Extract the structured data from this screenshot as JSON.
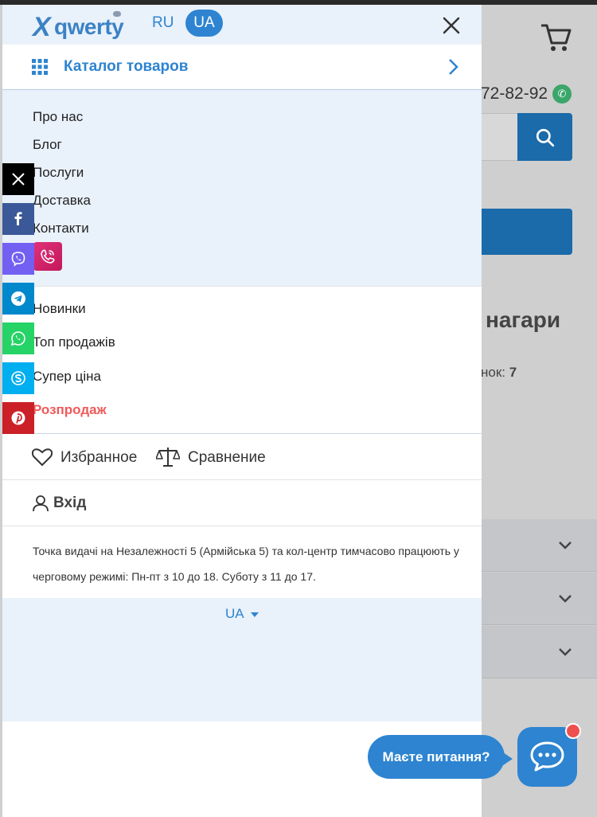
{
  "background": {
    "phone_fragment": "72-82-92",
    "heading_fragment": "нагари",
    "count_fragment": "нок:",
    "count_value": "7"
  },
  "header": {
    "logo_text": "qwerty",
    "lang_ru": "RU",
    "lang_ua": "UA"
  },
  "catalog": {
    "label": "Каталог товаров"
  },
  "info_links": [
    "Про нас",
    "Блог",
    "Послуги",
    "Доставка",
    "Контакти"
  ],
  "promo_links": [
    "Новинки",
    "Топ продажів",
    "Супер ціна",
    "Розпродаж"
  ],
  "favorites": {
    "favorites_label": "Избранное",
    "compare_label": "Сравнение"
  },
  "login": {
    "label": "Вхід"
  },
  "notice": {
    "text": "Точка видачі на Незалежності 5 (Армійська 5) та кол-центр тимчасово працюють у черговому режимі: Пн-пт з 10 до 18. Суботу з 11 до 17."
  },
  "language_selector": {
    "value": "UA"
  },
  "social_bar": [
    {
      "icon": "x-icon",
      "color": "#000000"
    },
    {
      "icon": "facebook-icon",
      "color": "#3b5998"
    },
    {
      "icon": "viber-icon",
      "color": "#7360f2"
    },
    {
      "icon": "telegram-icon",
      "color": "#0088cc"
    },
    {
      "icon": "whatsapp-icon",
      "color": "#25d366"
    },
    {
      "icon": "skype-icon",
      "color": "#00aff0"
    },
    {
      "icon": "pinterest-icon",
      "color": "#cb2027"
    }
  ],
  "chat": {
    "prompt": "Маєте питання?"
  },
  "colors": {
    "accent": "#2e84d0",
    "sale": "#ef5a5a",
    "drawer_tint": "#e9f1fa"
  }
}
